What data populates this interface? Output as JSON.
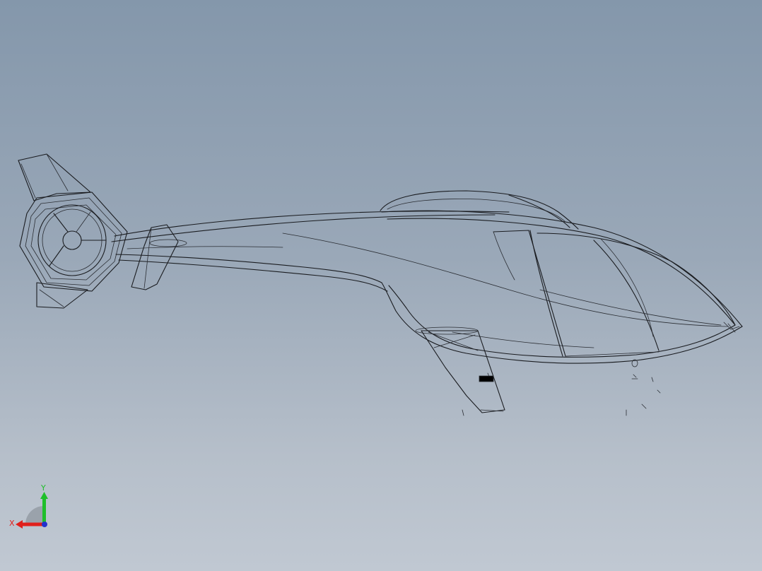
{
  "viewport": {
    "background_top": "#8497ab",
    "background_bottom": "#c0c8d2",
    "model_line_color": "#1a1c20"
  },
  "triad": {
    "x_label": "X",
    "y_label": "Y",
    "x_color": "#e0201c",
    "y_color": "#1fbf2a",
    "z_color": "#2233cc"
  }
}
